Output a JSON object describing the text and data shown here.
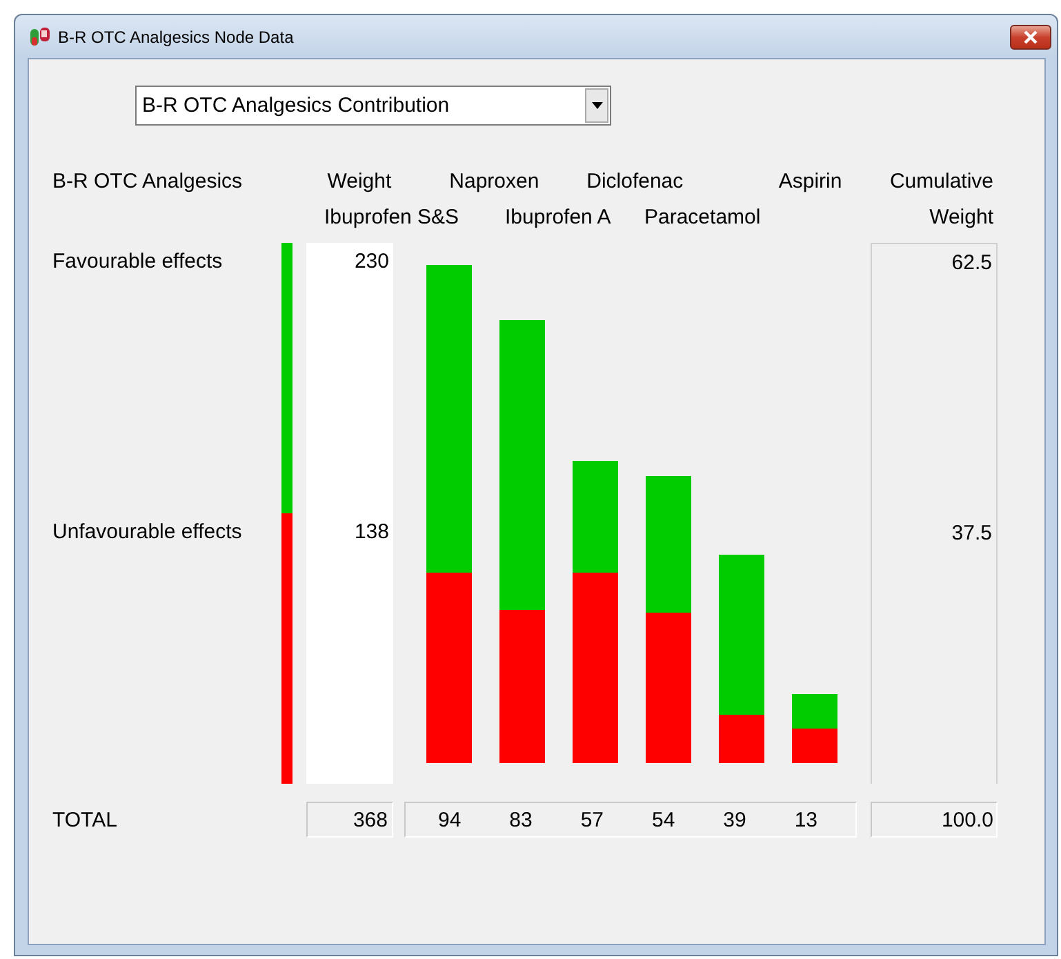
{
  "window": {
    "title": "B-R OTC Analgesics Node Data"
  },
  "dropdown": {
    "value": "B-R OTC Analgesics Contribution"
  },
  "headers": {
    "label": "B-R OTC Analgesics",
    "weight": "Weight",
    "cumulative": "Cumulative Weight"
  },
  "rows": [
    {
      "label": "Favourable effects",
      "weight": "230",
      "cumulative": "62.5"
    },
    {
      "label": "Unfavourable effects",
      "weight": "138",
      "cumulative": "37.5"
    }
  ],
  "weight_bar": {
    "level": 0.5
  },
  "alternatives": [
    "Ibuprofen S&S",
    "Naproxen",
    "Ibuprofen A",
    "Diclofenac",
    "Paracetamol",
    "Aspirin"
  ],
  "total": {
    "label": "TOTAL",
    "weight": "368",
    "alternatives": [
      "94",
      "83",
      "57",
      "54",
      "39",
      "13"
    ],
    "cumulative": "100.0"
  }
}
